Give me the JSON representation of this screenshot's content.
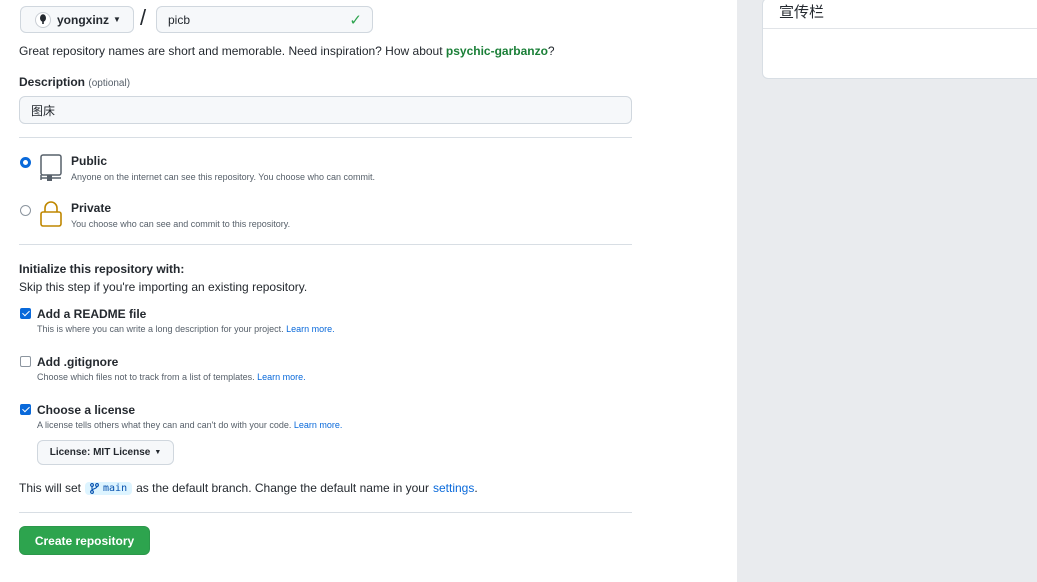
{
  "owner": {
    "name": "yongxinz"
  },
  "separator": "/",
  "repo_name": {
    "value": "picb"
  },
  "hint": {
    "prefix": "Great repository names are short and memorable. Need inspiration? How about ",
    "suggestion": "psychic-garbanzo",
    "suffix": "?"
  },
  "description": {
    "label": "Description",
    "optional": "(optional)",
    "value": "图床"
  },
  "visibility": {
    "public": {
      "title": "Public",
      "note": "Anyone on the internet can see this repository. You choose who can commit.",
      "selected": true
    },
    "private": {
      "title": "Private",
      "note": "You choose who can see and commit to this repository.",
      "selected": false
    }
  },
  "initialize": {
    "title": "Initialize this repository with:",
    "subtitle": "Skip this step if you're importing an existing repository.",
    "readme": {
      "title": "Add a README file",
      "note": "This is where you can write a long description for your project. ",
      "link": "Learn more.",
      "checked": true
    },
    "gitignore": {
      "title": "Add .gitignore",
      "note": "Choose which files not to track from a list of templates. ",
      "link": "Learn more.",
      "checked": false
    },
    "license": {
      "title": "Choose a license",
      "note": "A license tells others what they can and can't do with your code. ",
      "link": "Learn more.",
      "checked": true,
      "select_label": "License: MIT License"
    }
  },
  "branch": {
    "prefix": "This will set",
    "name": "main",
    "middle": "as the default branch. Change the default name in your",
    "link": "settings",
    "suffix": "."
  },
  "create_button": "Create repository",
  "sidebar": {
    "title": "宣传栏"
  },
  "colors": {
    "accent_blue": "#0969da",
    "create_green": "#2da44e",
    "suggestion_green": "#1a7f37",
    "sidebar_bg": "#e9ebee"
  }
}
